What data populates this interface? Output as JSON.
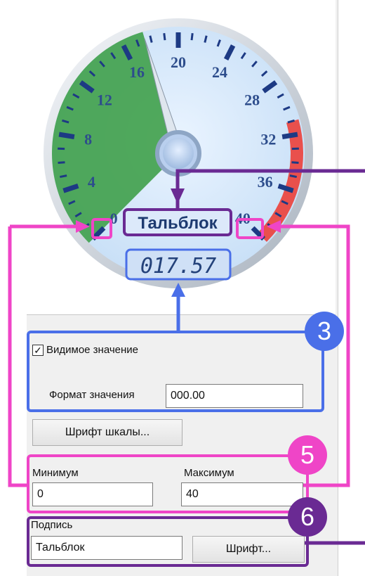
{
  "gauge": {
    "min": 0,
    "max": 40,
    "value": 17.57,
    "scale_labels": [
      "0",
      "4",
      "8",
      "12",
      "16",
      "20",
      "24",
      "28",
      "32",
      "36",
      "40"
    ],
    "caption": "Тальблок",
    "digital_display": "017.57",
    "green_sector_color": "#3fa04a",
    "red_band_color": "#e9504c",
    "face_color": "#c9e0f7",
    "needle_icon": "gauge-needle"
  },
  "value_section": {
    "checkbox_label": "Видимое значение",
    "checkbox_checked": true,
    "format_label": "Формат значения",
    "format_value": "000.00"
  },
  "scale_font_button": "Шрифт шкалы...",
  "range": {
    "min_label": "Минимум",
    "min_value": "0",
    "max_label": "Максимум",
    "max_value": "40"
  },
  "caption_section": {
    "label": "Подпись",
    "value": "Тальблок",
    "font_button": "Шрифт..."
  },
  "callouts": {
    "badge_3": "3",
    "badge_5": "5",
    "badge_6": "6",
    "blue_color": "#4a6fe8",
    "pink_color": "#ef45c7",
    "purple_color": "#6a2a93"
  }
}
